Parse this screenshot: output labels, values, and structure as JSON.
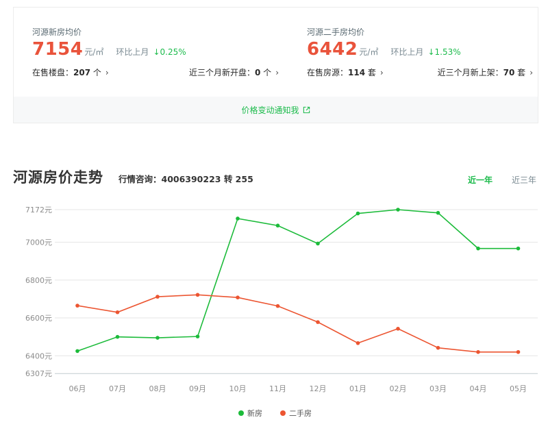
{
  "summary": {
    "new": {
      "title": "河源新房均价",
      "price": "7154",
      "unit": "元/㎡",
      "compare_label": "环比上月",
      "compare_value": "↓0.25%",
      "left_link": {
        "label": "在售楼盘：",
        "value": "207",
        "suffix": " 个"
      },
      "right_link": {
        "label": "近三个月新开盘：",
        "value": "0",
        "suffix": " 个"
      }
    },
    "second": {
      "title": "河源二手房均价",
      "price": "6442",
      "unit": "元/㎡",
      "compare_label": "环比上月",
      "compare_value": "↓1.53%",
      "left_link": {
        "label": "在售房源：",
        "value": "114",
        "suffix": " 套"
      },
      "right_link": {
        "label": "近三个月新上架：",
        "value": "70",
        "suffix": " 套"
      }
    },
    "chevron": "›",
    "notify_label": "价格变动通知我"
  },
  "trend": {
    "title": "河源房价走势",
    "hotline": "行情咨询：4006390223 转 255",
    "tabs": [
      "近一年",
      "近三年"
    ],
    "active_tab": "近一年"
  },
  "colors": {
    "new": "#1cbb3a",
    "second": "#ec5531",
    "accent_green": "#1cbb4c",
    "price_red": "#e9533b"
  },
  "chart_data": {
    "type": "line",
    "categories": [
      "06月",
      "07月",
      "08月",
      "09月",
      "10月",
      "11月",
      "12月",
      "01月",
      "02月",
      "03月",
      "04月",
      "05月"
    ],
    "series": [
      {
        "name": "新房",
        "color": "#1cbb3a",
        "values": [
          6425,
          6500,
          6495,
          6502,
          7125,
          7088,
          6993,
          7152,
          7172,
          7155,
          6967,
          6967
        ]
      },
      {
        "name": "二手房",
        "color": "#ec5531",
        "values": [
          6665,
          6630,
          6712,
          6722,
          6708,
          6663,
          6578,
          6467,
          6543,
          6442,
          6420,
          6420
        ]
      }
    ],
    "yticks": [
      7172,
      7000,
      6800,
      6600,
      6400,
      6307
    ],
    "ytick_labels": [
      "7172元",
      "7000元",
      "6800元",
      "6600元",
      "6400元",
      "6307元"
    ],
    "ylim": [
      6307,
      7172
    ],
    "grid": true,
    "legend_position": "bottom-center"
  }
}
